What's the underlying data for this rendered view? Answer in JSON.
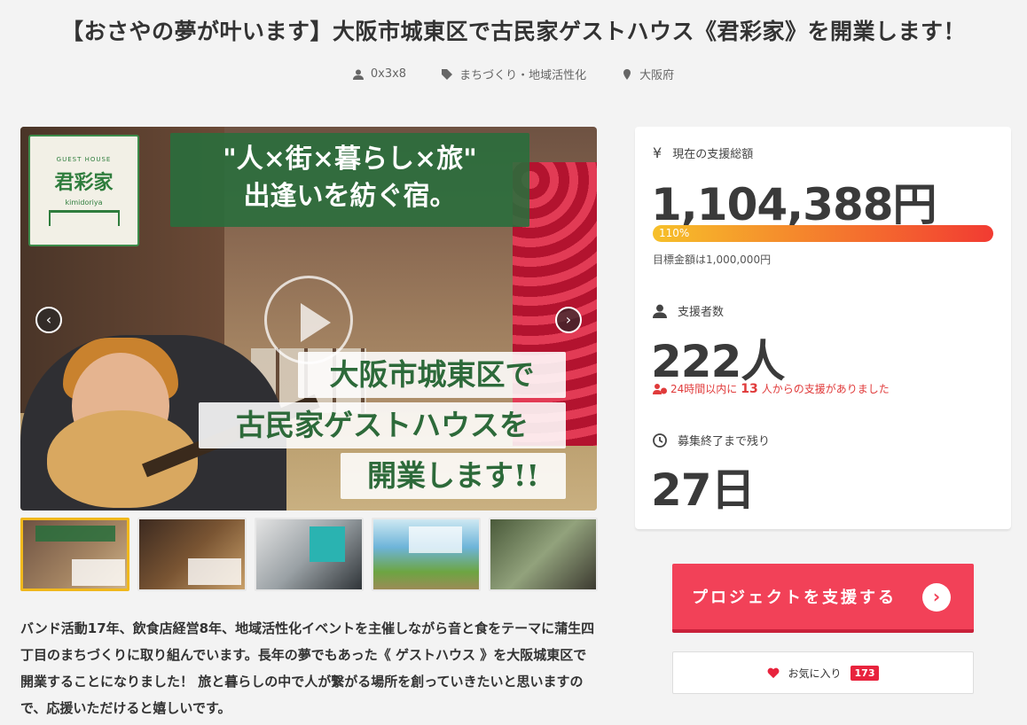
{
  "project": {
    "title": "【おさやの夢が叶います】大阪市城東区で古民家ゲストハウス《君彩家》を開業します！",
    "owner": "0x3x8",
    "category": "まちづくり・地域活性化",
    "location": "大阪府"
  },
  "visual": {
    "logo_small": "GUEST HOUSE",
    "logo_main": "君彩家",
    "logo_sub": "kimidoriya",
    "banner_line1": "\"人×街×暮らし×旅\"",
    "banner_line2": "出逢いを紡ぐ宿。",
    "overlay_line1": "大阪市城東区で",
    "overlay_line2": "古民家ゲストハウスを",
    "overlay_line3": "開業します!!",
    "prev": "‹",
    "next": "›"
  },
  "description": "バンド活動17年、飲食店経営8年、地域活性化イベントを主催しながら音と食をテーマに蒲生四丁目のまちづくりに取り組んでいます。長年の夢でもあった《 ゲストハウス 》を大阪城東区で開業することになりました！ 旅と暮らしの中で人が繋がる場所を創っていきたいと思いますので、応援いただけると嬉しいです。",
  "stats": {
    "total_label": "現在の支援総額",
    "total_value": "1,104,388円",
    "progress_text": "110%",
    "progress_percent": 110,
    "goal_text": "目標金額は1,000,000円",
    "supporters_label": "支援者数",
    "supporters_value": "222人",
    "recent_prefix": "24時間以内に",
    "recent_count": "13",
    "recent_suffix": "人からの支援がありました",
    "remaining_label": "募集終了まで残り",
    "remaining_value": "27日"
  },
  "actions": {
    "support_label": "プロジェクトを支援する",
    "support_arrow": "›",
    "favorite_label": "お気に入り",
    "favorite_count": "173"
  },
  "colors": {
    "accent": "#f24158",
    "progress_start": "#f6c02a",
    "progress_end": "#f23b32",
    "highlight": "#e03a3a"
  }
}
